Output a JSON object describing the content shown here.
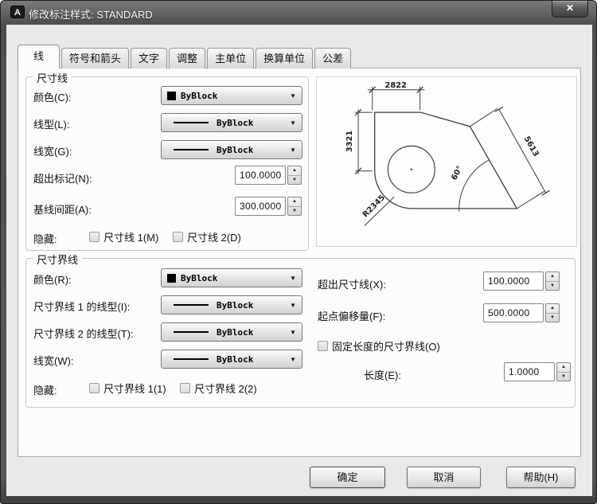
{
  "window": {
    "title": "修改标注样式: STANDARD"
  },
  "icons": {
    "app": "A",
    "close": "✕",
    "dropdown_arrow": "▼",
    "spin_up": "▲",
    "spin_down": "▼"
  },
  "colors": {
    "swatch": "#000000"
  },
  "tabs": [
    {
      "label": "线",
      "active": true
    },
    {
      "label": "符号和箭头",
      "active": false
    },
    {
      "label": "文字",
      "active": false
    },
    {
      "label": "调整",
      "active": false
    },
    {
      "label": "主单位",
      "active": false
    },
    {
      "label": "换算单位",
      "active": false
    },
    {
      "label": "公差",
      "active": false
    }
  ],
  "dim_line": {
    "title": "尺寸线",
    "color_label": "颜色(C):",
    "color_value": "ByBlock",
    "linetype_label": "线型(L):",
    "linetype_value": "ByBlock",
    "lineweight_label": "线宽(G):",
    "lineweight_value": "ByBlock",
    "extend_label": "超出标记(N):",
    "extend_value": "100.0000",
    "baseline_label": "基线间距(A):",
    "baseline_value": "300.0000",
    "suppress_label": "隐藏:",
    "suppress1": "尺寸线 1(M)",
    "suppress2": "尺寸线 2(D)"
  },
  "ext_line": {
    "title": "尺寸界线",
    "color_label": "颜色(R):",
    "color_value": "ByBlock",
    "linetype1_label": "尺寸界线 1 的线型(I):",
    "linetype1_value": "ByBlock",
    "linetype2_label": "尺寸界线 2 的线型(T):",
    "linetype2_value": "ByBlock",
    "lineweight_label": "线宽(W):",
    "lineweight_value": "ByBlock",
    "suppress_label": "隐藏:",
    "suppress1": "尺寸界线 1(1)",
    "suppress2": "尺寸界线 2(2)",
    "extend_label": "超出尺寸线(X):",
    "extend_value": "100.0000",
    "offset_label": "起点偏移量(F):",
    "offset_value": "500.0000",
    "fixed_label": "固定长度的尺寸界线(O)",
    "length_label": "长度(E):",
    "length_value": "1.0000"
  },
  "preview": {
    "dim_top": "2822",
    "dim_left": "3321",
    "dim_aligned": "5613",
    "dim_radius": "R2345",
    "dim_angle": "60°"
  },
  "footer": {
    "ok": "确定",
    "cancel": "取消",
    "help": "帮助(H)"
  }
}
